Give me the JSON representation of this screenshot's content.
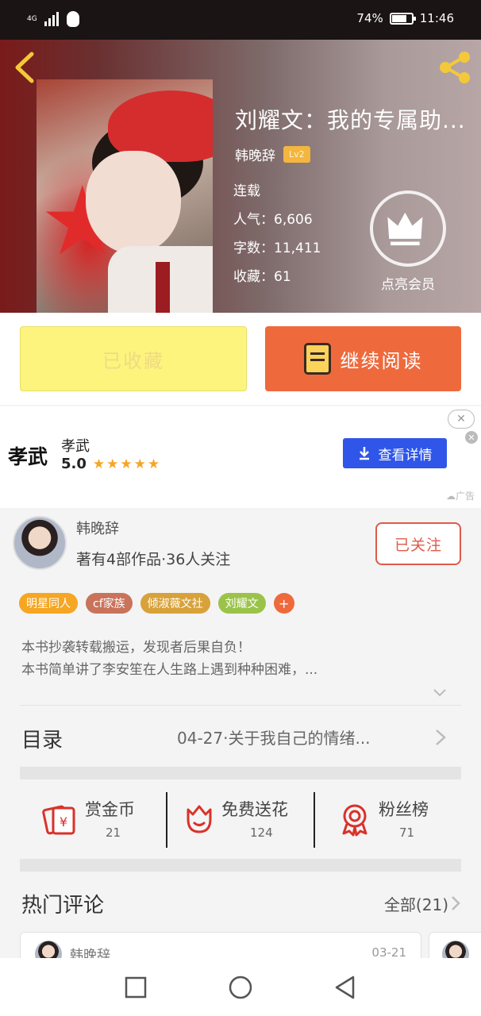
{
  "status_bar": {
    "network": "4G",
    "battery_percent": "74%",
    "time": "11:46"
  },
  "book": {
    "title": "刘耀文：我的专属助...",
    "author": "韩晚辞",
    "level": "Lv2",
    "status": "连载",
    "popularity": "人气：6,606",
    "word_count": "字数：11,411",
    "favorites": "收藏：61",
    "vip_label": "点亮会员"
  },
  "actions": {
    "collected_label": "已收藏",
    "continue_label": "继续阅读"
  },
  "ad": {
    "logo_text": "孝武",
    "name": "孝武",
    "rating": "5.0",
    "stars": "★★★★★",
    "button_label": "查看详情",
    "close_label": "✕",
    "tag": "广告"
  },
  "author_card": {
    "name": "韩晚辞",
    "description": "著有4部作品·36人关注",
    "follow_label": "已关注"
  },
  "tags": [
    {
      "label": "明星同人",
      "color": "#f5a623"
    },
    {
      "label": "cf家族",
      "color": "#c9735a"
    },
    {
      "label": "倾淑薇文社",
      "color": "#d8a23a"
    },
    {
      "label": "刘耀文",
      "color": "#9bc34a"
    }
  ],
  "tag_more": "+",
  "summary": {
    "line1": "本书抄袭转载搬运，发现者后果自负！",
    "line2": "本书简单讲了李安笙在人生路上遇到种种困难，..."
  },
  "toc": {
    "label": "目录",
    "latest": "04-27·关于我自己的情绪..."
  },
  "stats": [
    {
      "label": "赏金币",
      "value": "21",
      "icon": "reward-coin-icon"
    },
    {
      "label": "免费送花",
      "value": "124",
      "icon": "flower-icon"
    },
    {
      "label": "粉丝榜",
      "value": "71",
      "icon": "medal-icon"
    }
  ],
  "hot_comments": {
    "title": "热门评论",
    "all_label": "全部(21)",
    "first": {
      "name": "韩晚辞",
      "date": "03-21"
    }
  },
  "colors": {
    "accent": "#ee6a3c",
    "collected_bg": "#fdf47e",
    "ad_button": "#2f56e8"
  }
}
